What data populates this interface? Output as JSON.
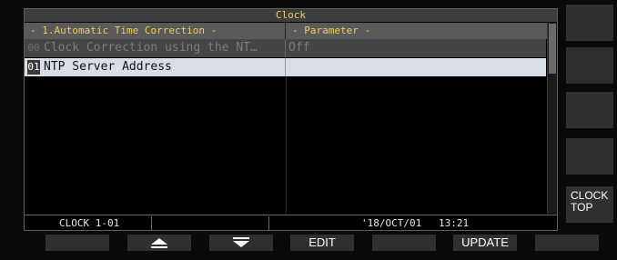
{
  "window": {
    "title": "Clock"
  },
  "table": {
    "headers": {
      "item": "- 1.Automatic Time Correction -",
      "parameter": "- Parameter -"
    },
    "rows": [
      {
        "index": "00",
        "label": "Clock Correction using the NT…",
        "value": "Off",
        "state": "disabled"
      },
      {
        "index": "01",
        "label": "NTP Server Address",
        "value": "",
        "state": "selected"
      }
    ]
  },
  "status_bar": {
    "page": "CLOCK 1-01",
    "date": "'18/OCT/01",
    "time": "13:21"
  },
  "side_keys": {
    "clock_top_line1": "CLOCK",
    "clock_top_line2": "TOP"
  },
  "bottom_keys": {
    "up_icon": "triangle-up-icon",
    "down_icon": "triangle-down-icon",
    "edit_label": "EDIT",
    "update_label": "UPDATE"
  },
  "colors": {
    "title_text": "#f1ce5a",
    "selected_row": "#d9dde5",
    "background": "#000000",
    "key_background": "#303030"
  }
}
